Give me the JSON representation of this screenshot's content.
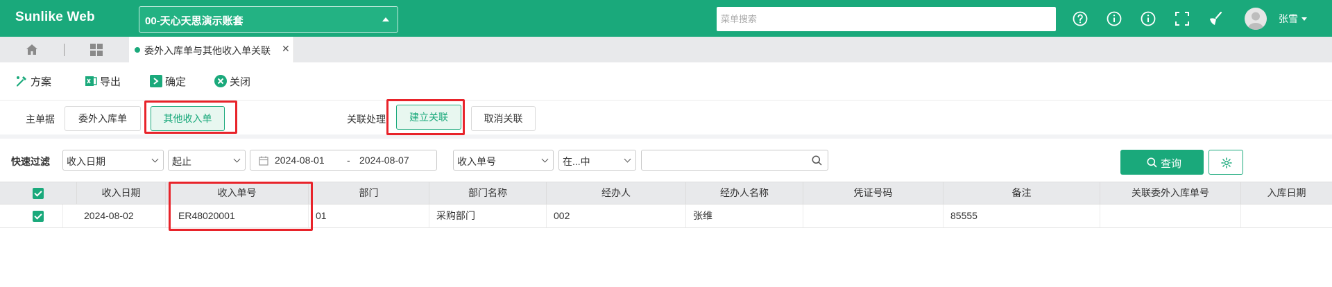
{
  "header": {
    "brand": "Sunlike Web",
    "account": "00-天心天思演示账套",
    "search_placeholder": "菜单搜索",
    "user_name": "张雪",
    "colors": {
      "primary": "#1aa97b",
      "highlight": "#e8232a"
    }
  },
  "tabs": {
    "active_label": "委外入库单与其他收入单关联"
  },
  "toolbar": {
    "scheme": "方案",
    "export": "导出",
    "confirm": "确定",
    "close": "关闭"
  },
  "assoc": {
    "master_label": "主单据",
    "outsourced_receipt": "委外入库单",
    "other_income": "其他收入单",
    "process_label": "关联处理",
    "create_link": "建立关联",
    "cancel_link": "取消关联"
  },
  "filter": {
    "label": "快速过滤",
    "field": "收入日期",
    "operator": "起止",
    "date_from": "2024-08-01",
    "date_sep": "-",
    "date_to": "2024-08-07",
    "field2": "收入单号",
    "operator2": "在...中",
    "value2": "",
    "query": "查询"
  },
  "table": {
    "columns": [
      "收入日期",
      "收入单号",
      "部门",
      "部门名称",
      "经办人",
      "经办人名称",
      "凭证号码",
      "备注",
      "关联委外入库单号",
      "入库日期"
    ],
    "rows": [
      {
        "cells": [
          "2024-08-02",
          "ER48020001",
          "01",
          "采购部门",
          "002",
          "张维",
          "",
          "85555",
          "",
          ""
        ]
      }
    ]
  }
}
